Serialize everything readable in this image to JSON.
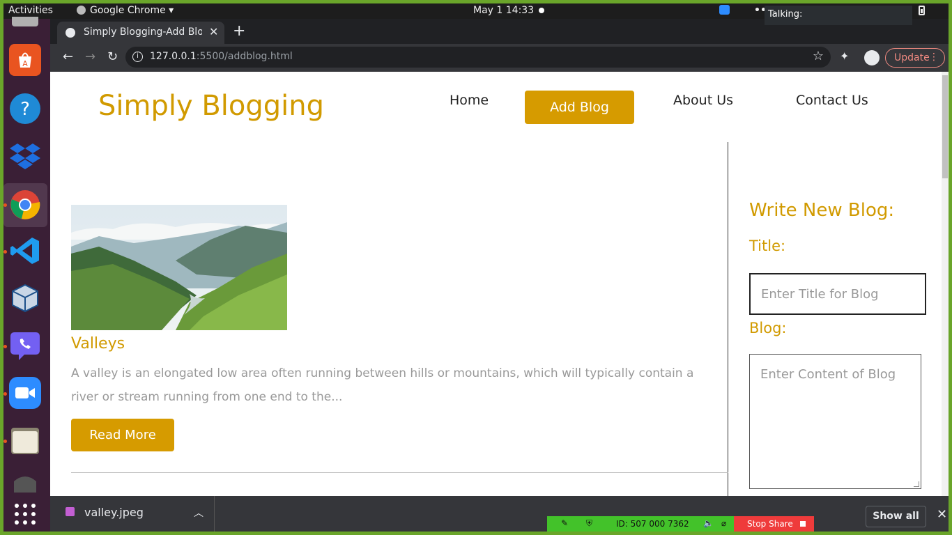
{
  "topbar": {
    "activities": "Activities",
    "app_menu": "Google Chrome ▾",
    "clock": "May 1  14:33",
    "talking": "Talking:"
  },
  "dock": {
    "items": [
      {
        "name": "Ubuntu Software",
        "icon": "software-store-icon"
      },
      {
        "name": "Help",
        "icon": "help-icon"
      },
      {
        "name": "Dropbox",
        "icon": "dropbox-icon"
      },
      {
        "name": "Google Chrome",
        "icon": "chrome-icon"
      },
      {
        "name": "VS Code",
        "icon": "vscode-icon"
      },
      {
        "name": "VirtualBox",
        "icon": "virtualbox-icon"
      },
      {
        "name": "Viber",
        "icon": "viber-icon"
      },
      {
        "name": "Zoom",
        "icon": "zoom-icon"
      },
      {
        "name": "Files",
        "icon": "files-icon"
      },
      {
        "name": "Show Applications",
        "icon": "app-grid-icon"
      }
    ]
  },
  "browser": {
    "tab_title": "Simply Blogging-Add Blog",
    "url_host": "127.0.0.1",
    "url_path": ":5500/addblog.html",
    "update_label": "Update"
  },
  "page": {
    "site_title": "Simply Blogging",
    "nav": {
      "home": "Home",
      "add_blog": "Add Blog",
      "about": "About Us",
      "contact": "Contact Us"
    },
    "post": {
      "title": "Valleys",
      "excerpt": "A valley is an elongated low area often running between hills or mountains, which will typically contain a river or stream running from one end to the...",
      "read_more": "Read More"
    },
    "sidebar": {
      "heading": "Write New Blog:",
      "title_label": "Title:",
      "title_placeholder": "Enter Title for Blog",
      "blog_label": "Blog:",
      "blog_placeholder": "Enter Content of Blog"
    }
  },
  "downloads": {
    "file": "valley.jpeg",
    "show_all": "Show all"
  },
  "zoom_share": {
    "id": "ID: 507 000 7362",
    "stop": "Stop Share"
  },
  "colors": {
    "accent": "#d69b00",
    "dock_bg": "#3a1f36",
    "share_green": "#43c22a",
    "stop_red": "#ef3b3b"
  }
}
